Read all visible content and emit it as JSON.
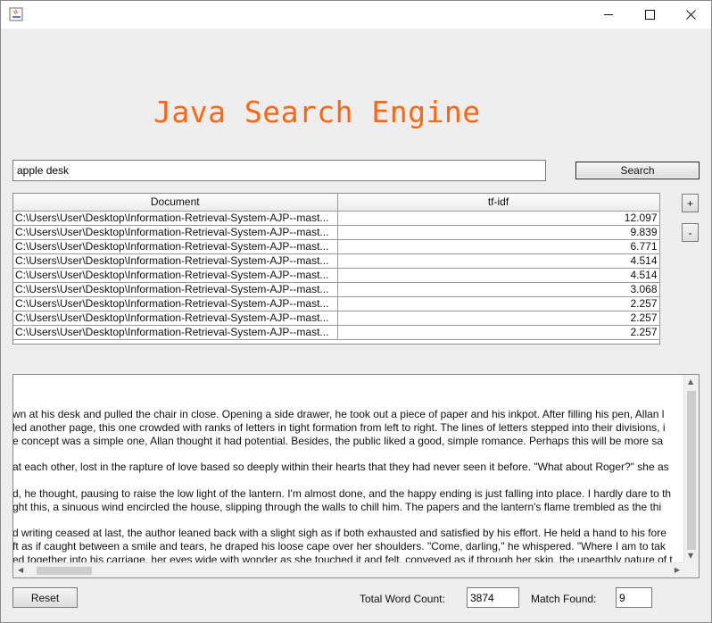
{
  "window": {
    "icon": "java-app-icon",
    "controls": {
      "minimize": "minimize-icon",
      "maximize": "maximize-icon",
      "close": "close-icon"
    }
  },
  "header": {
    "title": "Java Search Engine"
  },
  "search": {
    "query": "apple desk",
    "button_label": "Search"
  },
  "zoom": {
    "plus_label": "+",
    "minus_label": "-"
  },
  "results": {
    "columns": [
      "Document",
      "tf-idf"
    ],
    "rows": [
      {
        "document": "C:\\Users\\User\\Desktop\\Information-Retrieval-System-AJP--mast...",
        "tfidf": "12.097"
      },
      {
        "document": "C:\\Users\\User\\Desktop\\Information-Retrieval-System-AJP--mast...",
        "tfidf": "9.839"
      },
      {
        "document": "C:\\Users\\User\\Desktop\\Information-Retrieval-System-AJP--mast...",
        "tfidf": "6.771"
      },
      {
        "document": "C:\\Users\\User\\Desktop\\Information-Retrieval-System-AJP--mast...",
        "tfidf": "4.514"
      },
      {
        "document": "C:\\Users\\User\\Desktop\\Information-Retrieval-System-AJP--mast...",
        "tfidf": "4.514"
      },
      {
        "document": "C:\\Users\\User\\Desktop\\Information-Retrieval-System-AJP--mast...",
        "tfidf": "3.068"
      },
      {
        "document": "C:\\Users\\User\\Desktop\\Information-Retrieval-System-AJP--mast...",
        "tfidf": "2.257"
      },
      {
        "document": "C:\\Users\\User\\Desktop\\Information-Retrieval-System-AJP--mast...",
        "tfidf": "2.257"
      },
      {
        "document": "C:\\Users\\User\\Desktop\\Information-Retrieval-System-AJP--mast...",
        "tfidf": "2.257"
      }
    ]
  },
  "document_text": [
    "wn at his desk and pulled the chair in close. Opening a side drawer, he took out a piece of paper and his inkpot. After filling his pen, Allan l",
    "led another page, this one crowded with ranks of letters in tight formation from left to right. The lines of letters stepped into their divisions, i",
    "e concept was a simple one, Allan thought it had potential. Besides, the public liked a good, simple romance. Perhaps this will be more sa",
    " at each other, lost in the rapture of love based so deeply within their hearts that they had never seen it before. \"What about Roger?\" she as",
    "d, he thought, pausing to raise the low light of the lantern. I'm almost done, and the happy ending is just falling into place. I hardly dare to th",
    "ght this, a sinuous wind encircled the house, slipping through the walls to chill him. The papers and the lantern's flame trembled as the thi",
    "d writing ceased at last, the author leaned back with a slight sigh as if both exhausted and satisfied by his effort. He held a hand to his fore",
    "ft as if caught between a smile and tears, he draped his loose cape over her shoulders. \"Come, darling,\" he whispered. \"Where I am to tak",
    "ed together into his carriage, her eyes wide with wonder as she touched it and felt, conveyed as if through her skin, the unearthly nature of t"
  ],
  "footer": {
    "reset_label": "Reset",
    "word_count_label": "Total Word Count:",
    "word_count": "3874",
    "match_label": "Match Found:",
    "match_count": "9"
  }
}
